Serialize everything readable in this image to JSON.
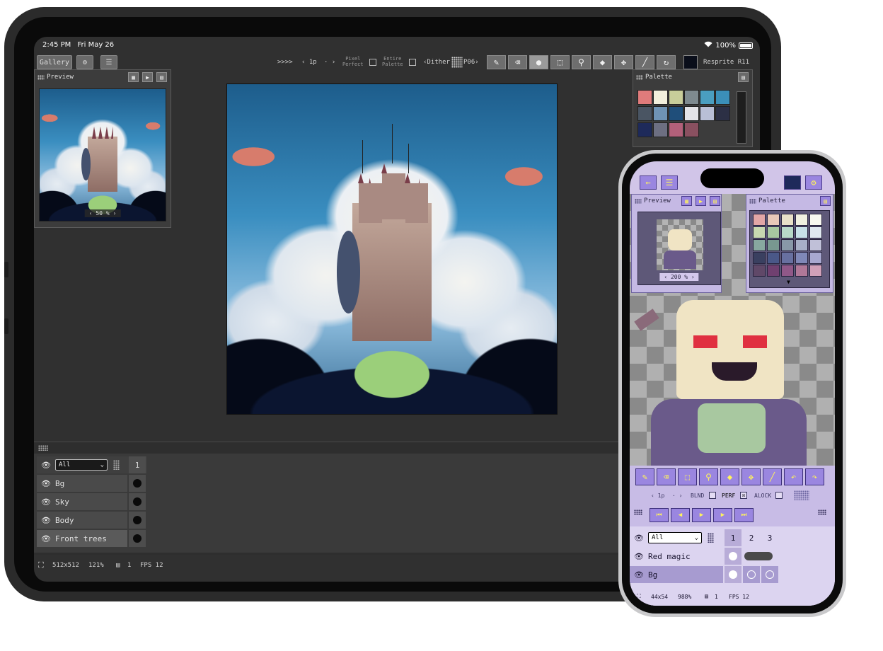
{
  "ipad": {
    "status": {
      "time": "2:45 PM",
      "date": "Fri May 26",
      "battery": "100%"
    },
    "toolbar": {
      "gallery": "Gallery",
      "step_arrows": ">>>>",
      "brush_size": "‹ 1p",
      "brush_size_arrows": "· ›",
      "pixel_perfect": [
        "Pixel",
        "Perfect"
      ],
      "entire_palette": [
        "Entire",
        "Palette"
      ],
      "dither": "‹Dither",
      "dither_pattern": "P06›",
      "tools": [
        "pencil-icon",
        "eraser-icon",
        "circle-icon",
        "selection-icon",
        "eyedropper-icon",
        "fill-icon",
        "move-icon",
        "line-icon",
        "rotate-icon"
      ],
      "active_tool": 2,
      "color": "#0a0e1a",
      "version": "Resprite R11"
    },
    "preview_panel": {
      "title": "Preview",
      "zoom": "‹ 50 % ›"
    },
    "palette_panel": {
      "title": "Palette",
      "colors": [
        "#e07b7b",
        "#f2efdc",
        "#c8cd9a",
        "#7e8a8f",
        "#4a9ec0",
        "#3b8fb8",
        "#4a5563",
        "#6f93b5",
        "#1f4e7a",
        "#e3e3e7",
        "#b9bfd6",
        "#2c3045",
        "#1e2a5a",
        "#6d6f82",
        "#b2607a",
        "#8a5060"
      ]
    },
    "layers": {
      "filter": "All",
      "frame_number": "1",
      "rows": [
        {
          "name": "Bg"
        },
        {
          "name": "Sky"
        },
        {
          "name": "Body"
        },
        {
          "name": "Front trees"
        }
      ],
      "active_index": 3
    },
    "footer": {
      "size": "512x512",
      "zoom": "121%",
      "frames": "1",
      "fps": "FPS 12"
    }
  },
  "iphone": {
    "preview_panel": {
      "title": "Preview",
      "zoom": "‹ 200 % ›"
    },
    "palette_panel": {
      "title": "Palette",
      "colors": [
        "#e2a6a6",
        "#e8c8b8",
        "#e8e0c8",
        "#f0f0e0",
        "#f8f8f0",
        "#c8d8b0",
        "#a8c8a0",
        "#b8d8c8",
        "#c8e0e8",
        "#e0e8f0",
        "#88a8a0",
        "#789890",
        "#8898a8",
        "#a8b0c8",
        "#c0c0d8",
        "#3a4060",
        "#4a5888",
        "#6870a0",
        "#8088b8",
        "#a8a8d0",
        "#604868",
        "#704070",
        "#905888",
        "#b07898",
        "#d0a0b8"
      ]
    },
    "tools": [
      "pencil-icon",
      "eraser-icon",
      "selection-icon",
      "eyedropper-icon",
      "fill-icon",
      "move-icon",
      "line-icon",
      "undo-icon",
      "redo-icon"
    ],
    "tool_options": {
      "size": "‹ 1p",
      "size_arrows": "· ›",
      "blend": "BLND",
      "perfect": "PERF",
      "perfect_checked": "☒",
      "alpha_lock": "ALOCK"
    },
    "playback": [
      "first-frame-icon",
      "prev-frame-icon",
      "play-icon",
      "next-frame-icon",
      "last-frame-icon"
    ],
    "layers": {
      "filter": "All",
      "frames": [
        "1",
        "2",
        "3"
      ],
      "rows": [
        {
          "name": "Red magic"
        },
        {
          "name": "Bg"
        }
      ],
      "active_index": 1
    },
    "footer": {
      "size": "44x54",
      "zoom": "988%",
      "frames": "1",
      "fps": "FPS 12"
    }
  }
}
